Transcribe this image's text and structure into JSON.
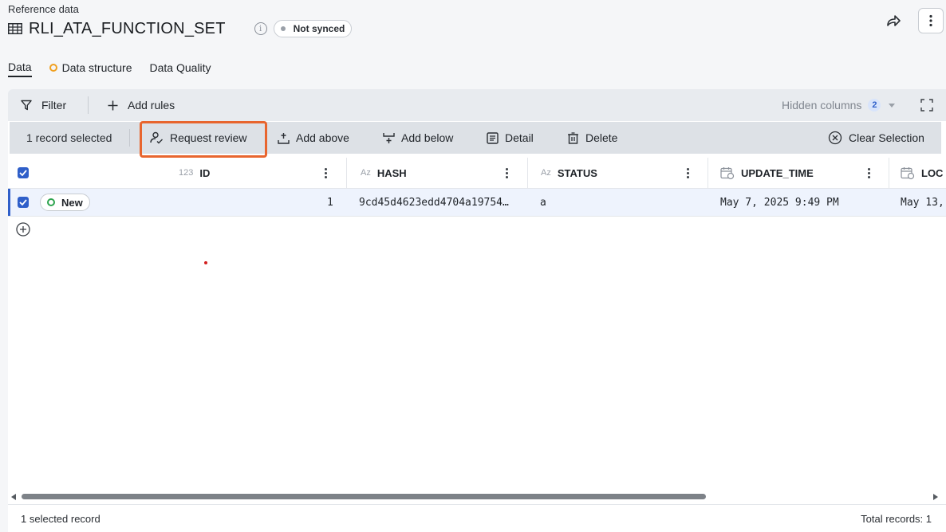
{
  "header": {
    "subtitle": "Reference data",
    "title": "RLI_ATA_FUNCTION_SET",
    "info_icon": "info-icon",
    "sync_status": "Not synced",
    "share_icon": "share-icon",
    "more_icon": "more-vertical-icon"
  },
  "tabs": [
    {
      "label": "Data",
      "active": true
    },
    {
      "label": "Data structure",
      "active": false,
      "indicator": "warning-dot"
    },
    {
      "label": "Data Quality",
      "active": false
    }
  ],
  "toolbar": {
    "filter_label": "Filter",
    "add_rules_label": "Add rules",
    "hidden_columns_label": "Hidden columns",
    "hidden_columns_count": "2",
    "expand_icon": "fullscreen-icon"
  },
  "selection_bar": {
    "selected_label": "1 record selected",
    "request_review": "Request review",
    "add_above": "Add above",
    "add_below": "Add below",
    "detail": "Detail",
    "delete": "Delete",
    "clear_selection": "Clear Selection"
  },
  "columns": [
    {
      "type": "123",
      "name": "ID"
    },
    {
      "type": "Az",
      "name": "HASH"
    },
    {
      "type": "Az",
      "name": "STATUS"
    },
    {
      "type": "date",
      "name": "UPDATE_TIME"
    },
    {
      "type": "date",
      "name": "LOC"
    }
  ],
  "rows": [
    {
      "badge": "New",
      "id": "1",
      "hash": "9cd45d4623edd4704a19754…",
      "status": "a",
      "update_time": "May 7, 2025 9:49 PM",
      "loc": "May 13,"
    }
  ],
  "footer": {
    "selected": "1 selected record",
    "total": "Total records: 1"
  },
  "colors": {
    "accent": "#2f5fc9",
    "highlight": "#e8652e",
    "new_badge": "#2ea44f",
    "warning": "#f0a020"
  }
}
